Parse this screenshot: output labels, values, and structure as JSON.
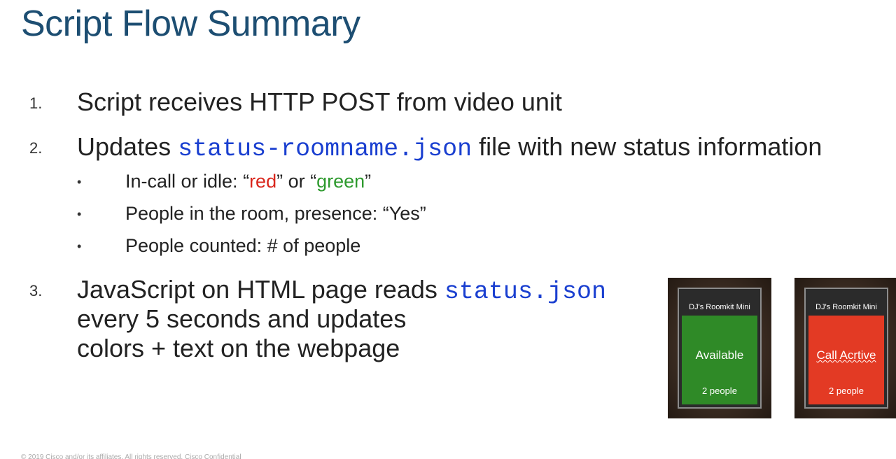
{
  "title": "Script Flow Summary",
  "steps": [
    {
      "number": "1.",
      "text": "Script receives HTTP POST from video unit"
    },
    {
      "number": "2.",
      "text_before": "Updates ",
      "code": "status-roomname.json",
      "text_after": " file with new status information",
      "bullets": [
        {
          "dot": "•",
          "prefix": "In-call or idle:  “",
          "red_word": "red",
          "middle": "” or “",
          "green_word": "green",
          "suffix": "”"
        },
        {
          "dot": "•",
          "text": "People in the room, presence: “Yes”"
        },
        {
          "dot": "•",
          "text": "People counted: # of people"
        }
      ]
    },
    {
      "number": "3.",
      "line1_before": "JavaScript on HTML page reads ",
      "code": "status.json",
      "line2": "every 5 seconds and updates",
      "line3": "colors + text on the webpage"
    }
  ],
  "displays": [
    {
      "room": "DJ's Roomkit Mini",
      "status": "Available",
      "people": "2 people",
      "color": "#2f8a27"
    },
    {
      "room": "DJ's Roomkit Mini",
      "status": "Call Acrtive",
      "people": "2 people",
      "color": "#e33a24"
    }
  ],
  "footer": "© 2019 Cisco and/or its affiliates. All rights reserved. Cisco Confidential"
}
